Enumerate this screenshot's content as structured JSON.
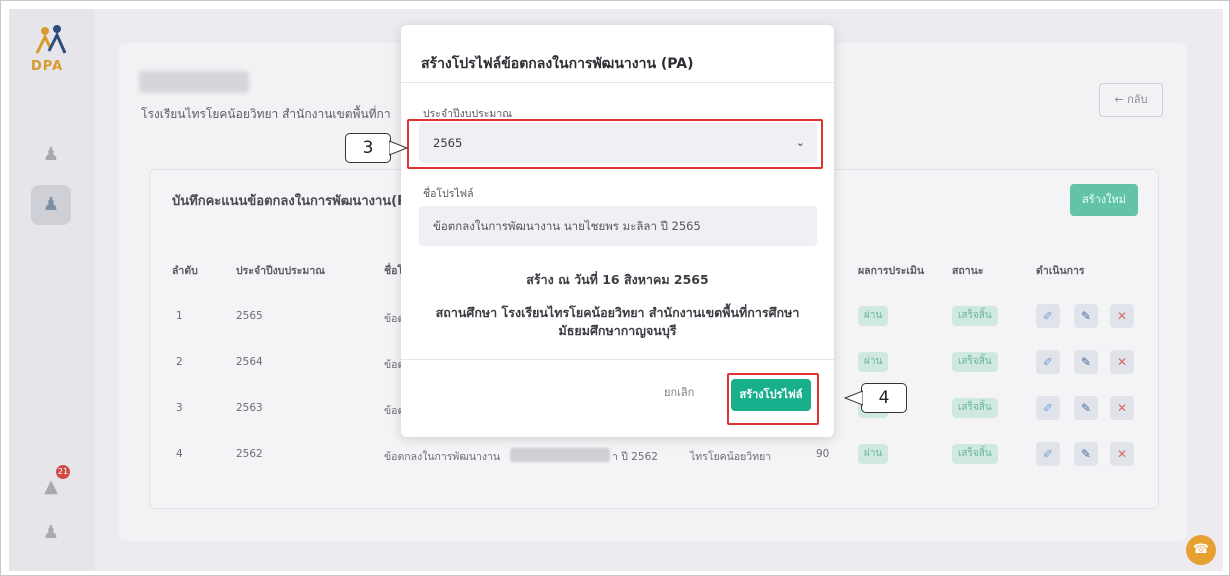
{
  "app": {
    "logo_text": "DPA",
    "notification_count": "21"
  },
  "header": {
    "school_line": "โรงเรียนไทรโยคน้อยวิทยา สำนักงานเขตพื้นที่กา",
    "back_label": "← กลับ"
  },
  "records": {
    "title": "บันทึกคะแนนข้อตกลงในการพัฒนางาน(P",
    "new_label": "สร้างใหม่",
    "columns": {
      "no": "ลำดับ",
      "year": "ประจำปีงบประมาณ",
      "name": "ชื่อโป",
      "result": "ผลการประเมิน",
      "status": "สถานะ",
      "action": "ดำเนินการ"
    },
    "rows": [
      {
        "no": "1",
        "year": "2565",
        "name": "ข้อตก",
        "result": "ผ่าน",
        "status": "เสร็จสิ้น"
      },
      {
        "no": "2",
        "year": "2564",
        "name": "ข้อตก",
        "result": "ผ่าน",
        "status": "เสร็จสิ้น"
      },
      {
        "no": "3",
        "year": "2563",
        "name": "ข้อตก",
        "result": "ผ่าน",
        "status": "เสร็จสิ้น"
      },
      {
        "no": "4",
        "year": "2562",
        "name": "ข้อตกลงในการพัฒนางาน",
        "name_tail": "า ปี 2562",
        "school": "ไทรโยคน้อยวิทยา",
        "score": "90",
        "result": "ผ่าน",
        "status": "เสร็จสิ้น"
      }
    ]
  },
  "modal": {
    "title": "สร้างโปรไฟล์ข้อตกลงในการพัฒนางาน (PA)",
    "year_label": "ประจำปีงบประมาณ",
    "year_value": "2565",
    "profile_label": "ชื่อโปรไฟล์",
    "profile_value": "ข้อตกลงในการพัฒนางาน นายไชยพร มะลิลา ปี 2565",
    "created_text": "สร้าง ณ วันที่ 16 สิงหาคม 2565",
    "school_text": "สถานศึกษา โรงเรียนไทรโยคน้อยวิทยา สำนักงานเขตพื้นที่การศึกษามัธยมศึกษากาญจนบุรี",
    "cancel_label": "ยกเลิก",
    "create_label": "สร้างโปรไฟล์"
  },
  "annotations": {
    "step3": "3",
    "step4": "4"
  },
  "colors": {
    "accent": "#18b08c",
    "highlight": "#e03232"
  }
}
